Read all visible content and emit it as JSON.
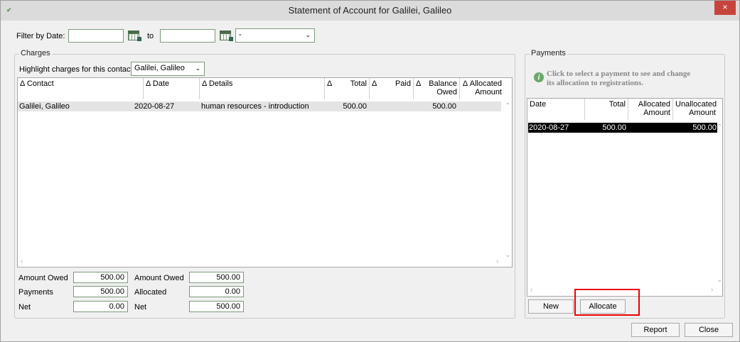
{
  "window": {
    "title": "Statement of Account for Galilei, Galileo",
    "close": "×"
  },
  "filter": {
    "label": "Filter by Date:",
    "to": "to",
    "from_value": "",
    "to_value": "",
    "dropdown_value": "-"
  },
  "charges": {
    "group_label": "Charges",
    "highlight_label": "Highlight charges for this contact",
    "highlight_value": "Galilei, Galileo",
    "columns": {
      "contact": "Contact",
      "date": "Date",
      "details": "Details",
      "total": "Total",
      "paid": "Paid",
      "balance_line1": "Balance",
      "balance_line2": "Owed",
      "allocated_line1": "Allocated",
      "allocated_line2": "Amount",
      "sort_glyph": "Δ"
    },
    "rows": [
      {
        "contact": "Galilei, Galileo",
        "date": "2020-08-27",
        "details": "human resources - introduction",
        "total": "500.00",
        "paid": "",
        "balance": "500.00",
        "allocated": ""
      }
    ],
    "summary": {
      "amount_owed_label": "Amount Owed",
      "amount_owed_value": "500.00",
      "payments_label": "Payments",
      "payments_value": "500.00",
      "net_label": "Net",
      "net_value": "0.00",
      "amount_owed2_label": "Amount Owed",
      "amount_owed2_value": "500.00",
      "allocated_label": "Allocated",
      "allocated_value": "0.00",
      "net2_label": "Net",
      "net2_value": "500.00"
    }
  },
  "payments": {
    "group_label": "Payments",
    "info_line1": "Click to select a payment to see and change",
    "info_line2": "its allocation to registrations.",
    "columns": {
      "date": "Date",
      "total": "Total",
      "allocated_line1": "Allocated",
      "allocated_line2": "Amount",
      "unallocated_line1": "Unallocated",
      "unallocated_line2": "Amount"
    },
    "rows": [
      {
        "date": "2020-08-27",
        "total": "500.00",
        "allocated": "",
        "unallocated": "500.00"
      }
    ],
    "new_button": "New",
    "allocate_button": "Allocate"
  },
  "footer": {
    "report_button": "Report",
    "close_button": "Close"
  },
  "colors": {
    "titlebar": "#dbdbdb",
    "close": "#c7443d",
    "selected_row": "#000000",
    "highlight_border": "#e00000"
  }
}
